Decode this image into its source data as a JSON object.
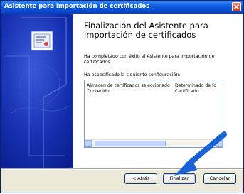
{
  "window": {
    "title": "Asistente para importación de certificados"
  },
  "content": {
    "heading": "Finalización del Asistente para importación de certificados",
    "completed_text": "Ha completado con éxito el Asistente para importación de certificados.",
    "config_label": "Ha especificado la siguiente configuración:",
    "settings": [
      {
        "key": "Almacén de certificados seleccionado",
        "value": "Determinado de fo"
      },
      {
        "key": "Contenido",
        "value": "Certificado"
      }
    ]
  },
  "buttons": {
    "back": "< Atrás",
    "finish": "Finalizar",
    "cancel": "Cancelar"
  },
  "icons": {
    "close": "close-icon",
    "certificate": "certificate-icon",
    "pointer": "arrow-pointer-icon"
  },
  "colors": {
    "title_bar": "#0a5ae0",
    "banner": "#0a1e8c",
    "arrow": "#1a63d6"
  }
}
